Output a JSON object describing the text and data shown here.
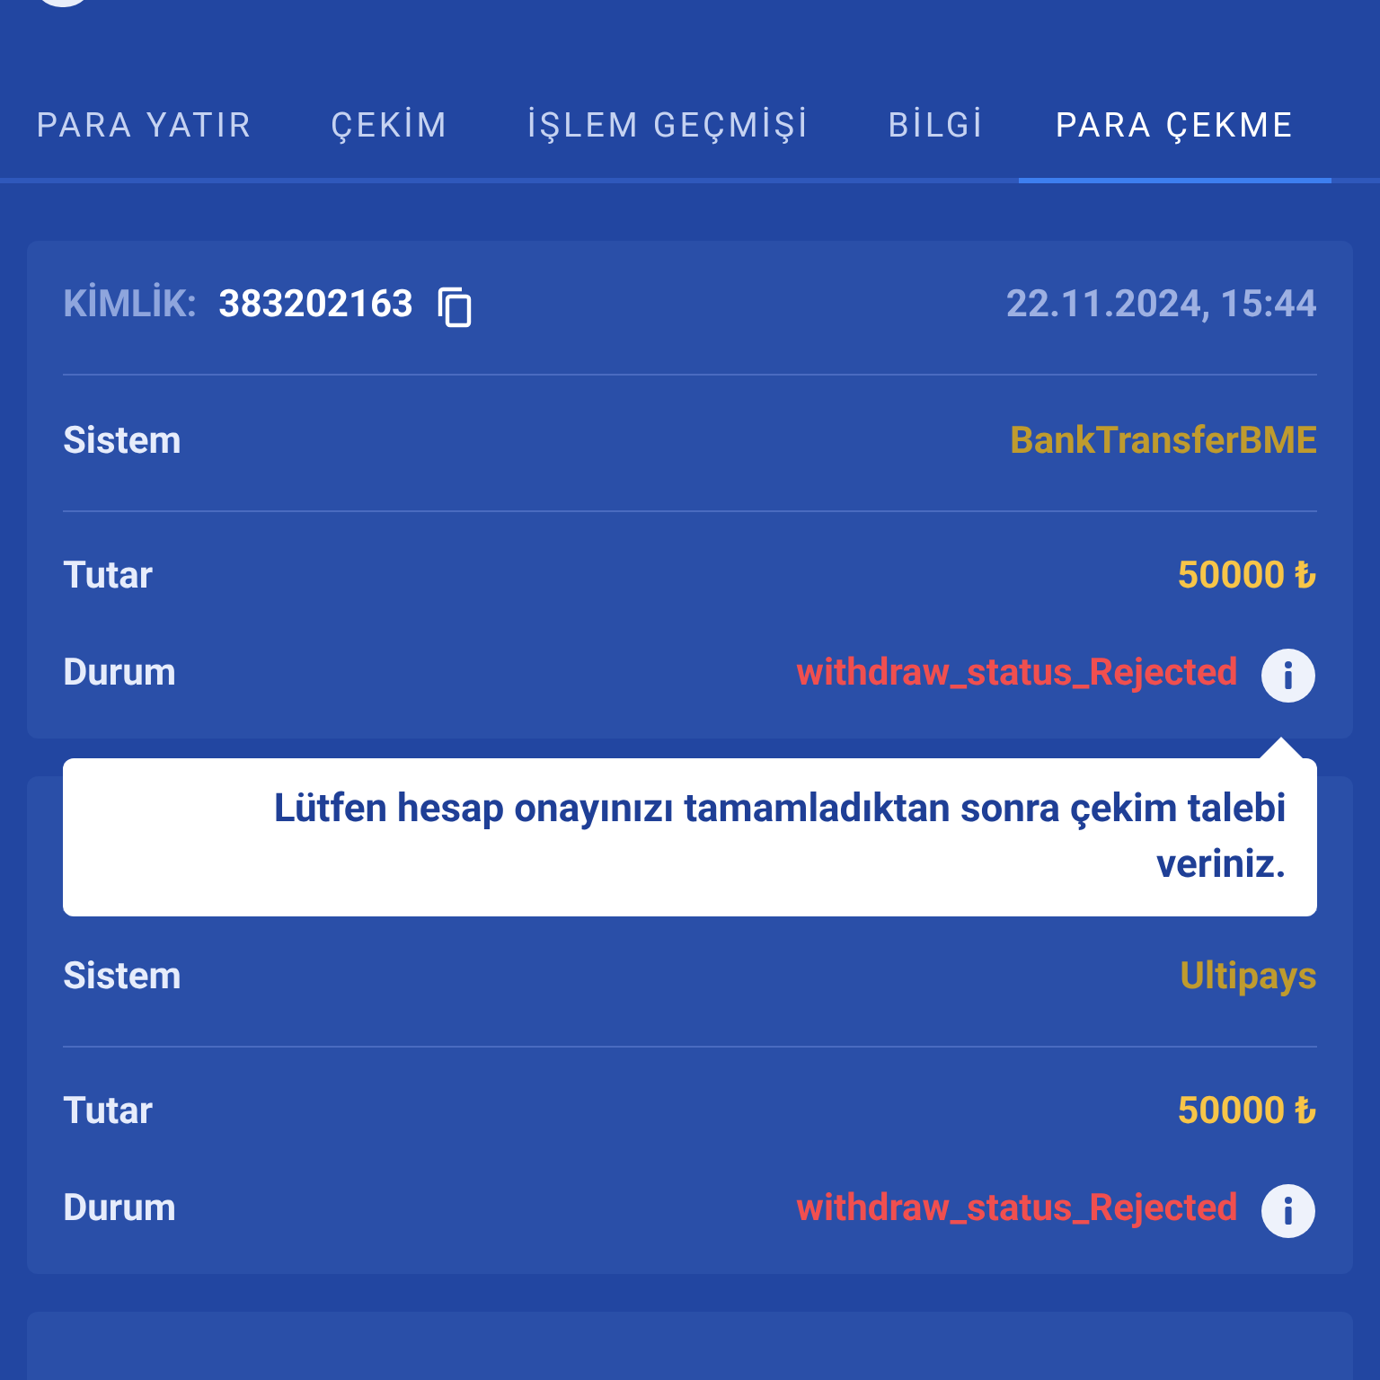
{
  "tabs": [
    {
      "label": "PARA YATIR",
      "selected": false
    },
    {
      "label": "ÇEKİM",
      "selected": false
    },
    {
      "label": "İŞLEM GEÇMİŞİ",
      "selected": false
    },
    {
      "label": "BİLGİ",
      "selected": false
    },
    {
      "label": "PARA ÇEKME",
      "selected": true
    }
  ],
  "withdrawals": [
    {
      "id_label": "KİMLİK:",
      "id": "383202163",
      "date": "22.11.2024, 15:44",
      "rows": [
        {
          "label": "Sistem",
          "value": "BankTransferBME",
          "kind": "system"
        },
        {
          "label": "Tutar",
          "value": "50000 ₺",
          "kind": "amount"
        },
        {
          "label": "Durum",
          "value": "withdraw_status_Rejected",
          "kind": "status"
        }
      ],
      "tooltip": "Lütfen hesap onayınızı tamamladıktan sonra çekim talebi veriniz."
    },
    {
      "rows": [
        {
          "label": "Sistem",
          "value": "Ultipays",
          "kind": "system"
        },
        {
          "label": "Tutar",
          "value": "50000 ₺",
          "kind": "amount"
        },
        {
          "label": "Durum",
          "value": "withdraw_status_Rejected",
          "kind": "status"
        }
      ]
    }
  ]
}
